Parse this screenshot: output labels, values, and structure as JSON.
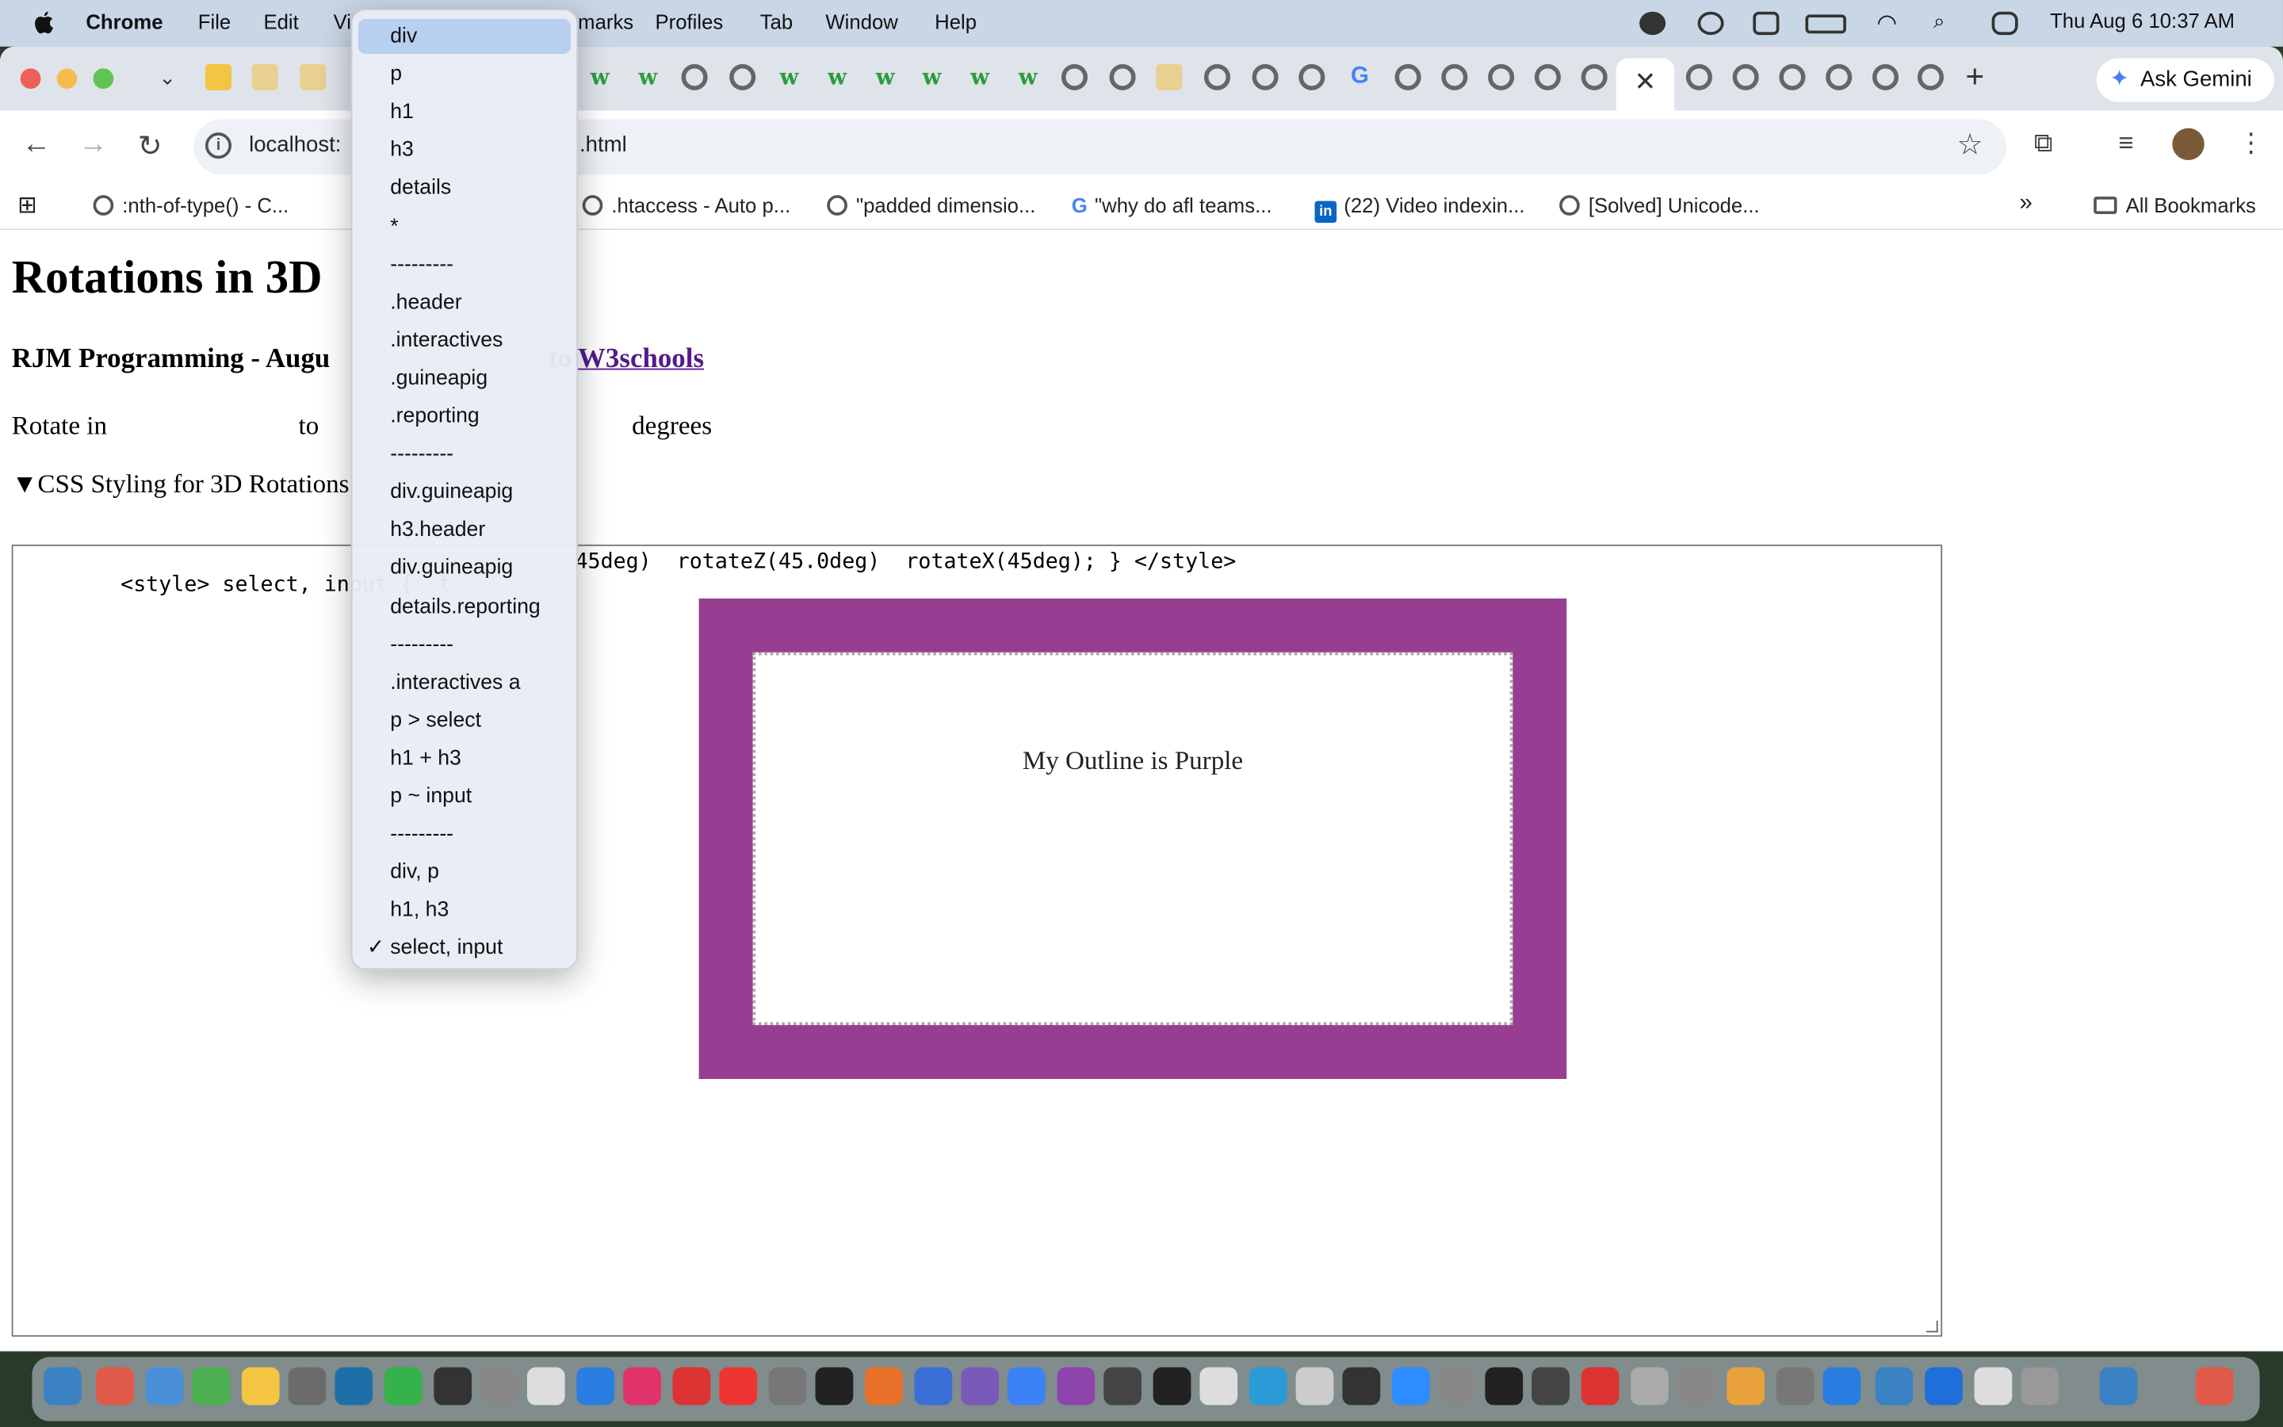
{
  "menubar": {
    "app": "Chrome",
    "items": [
      "File",
      "Edit",
      "Vi",
      "marks",
      "Profiles",
      "Tab",
      "Window",
      "Help"
    ],
    "clock": "Thu Aug 6  10:37 AM"
  },
  "tabs": {
    "close_glyph": "✕",
    "new_tab_glyph": "+",
    "gemini_label": "Ask Gemini"
  },
  "toolbar": {
    "url_start": "localhost:",
    "url_end": ".html"
  },
  "bookmarks": [
    ":nth-of-type() - C...",
    ".htaccess - Auto p...",
    "\"padded dimensio...",
    "\"why do afl teams...",
    "(22) Video indexin...",
    "[Solved] Unicode...",
    "All Bookmarks"
  ],
  "page": {
    "title": "Rotations in 3D",
    "subtitle_start": "RJM Programming - Augu",
    "subtitle_mid": "to",
    "subtitle_link": "W3schools",
    "rotate_label": "Rotate in",
    "to_label": "to",
    "degrees_label": "degrees",
    "details_summary": "▼CSS Styling for 3D Rotations",
    "code_line_a": "<style> select, input {  t",
    "code_line_b": "45deg)  rotateZ(45.0deg)  rotateX(45deg); } </style>",
    "box_message": "My Outline is Purple"
  },
  "dropdown": {
    "items": [
      "div",
      "p",
      "h1",
      "h3",
      "details",
      "*",
      "---------",
      ".header",
      ".interactives",
      ".guineapig",
      ".reporting",
      "---------",
      "div.guineapig",
      "h3.header",
      "div.guineapig",
      "details.reporting",
      "---------",
      ".interactives a",
      "p > select",
      "h1 + h3",
      "p ~ input",
      "---------",
      "div, p",
      "h1, h3",
      "select, input"
    ],
    "highlighted_index": 0,
    "checked_index": 24,
    "check_glyph": "✓"
  },
  "colors": {
    "purple_outline": "#983e92",
    "link": "#551a8b",
    "menu_highlight": "#b8cff0"
  }
}
